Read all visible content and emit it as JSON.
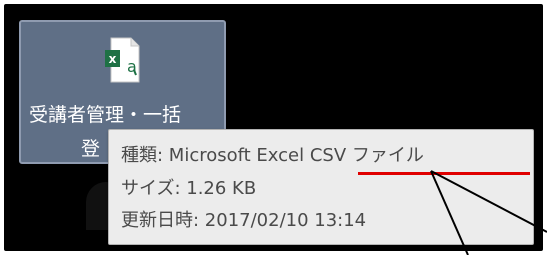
{
  "desktop_icon": {
    "label_line1": "受講者管理・一括",
    "label_line2": "登",
    "icon": "excel-csv-file-icon",
    "icon_letter": "a"
  },
  "tooltip": {
    "type_text": "種類: Microsoft Excel CSV ファイル",
    "size_text": "サイズ: 1.26 KB",
    "modified_text": "更新日時: 2017/02/10 13:14"
  },
  "colors": {
    "selection": "#5f6f86",
    "highlight": "#e00000",
    "excel_green": "#1e7145"
  }
}
